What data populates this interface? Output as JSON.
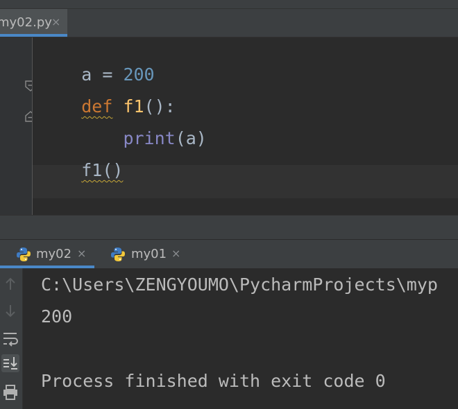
{
  "editor": {
    "tab": {
      "label": "my02.py",
      "close": "×"
    },
    "lines": {
      "l1": {
        "a": "a",
        "eq": " = ",
        "num": "200"
      },
      "l2": {
        "kw": "def",
        "sp": " ",
        "fn": "f1",
        "rest": "():"
      },
      "l3": {
        "indent": "    ",
        "builtin": "print",
        "rest": "(a)"
      },
      "l4": {
        "call": "f1()"
      }
    }
  },
  "run": {
    "tabs": [
      {
        "label": "my02",
        "close": "×"
      },
      {
        "label": "my01",
        "close": "×"
      }
    ],
    "console": {
      "path": "C:\\Users\\ZENGYOUMO\\PycharmProjects\\myp",
      "output": "200",
      "finished": "Process finished with exit code 0"
    }
  },
  "colors": {
    "background": "#2b2b2b",
    "keyword": "#cc7832",
    "function": "#ffc66d",
    "number": "#6897bb",
    "builtin": "#8888c6",
    "accent": "#4a88c7"
  },
  "icons": [
    "python-icon",
    "fold-icon",
    "up-arrow-icon",
    "down-arrow-icon",
    "soft-wrap-icon",
    "scroll-to-end-icon",
    "print-icon"
  ]
}
